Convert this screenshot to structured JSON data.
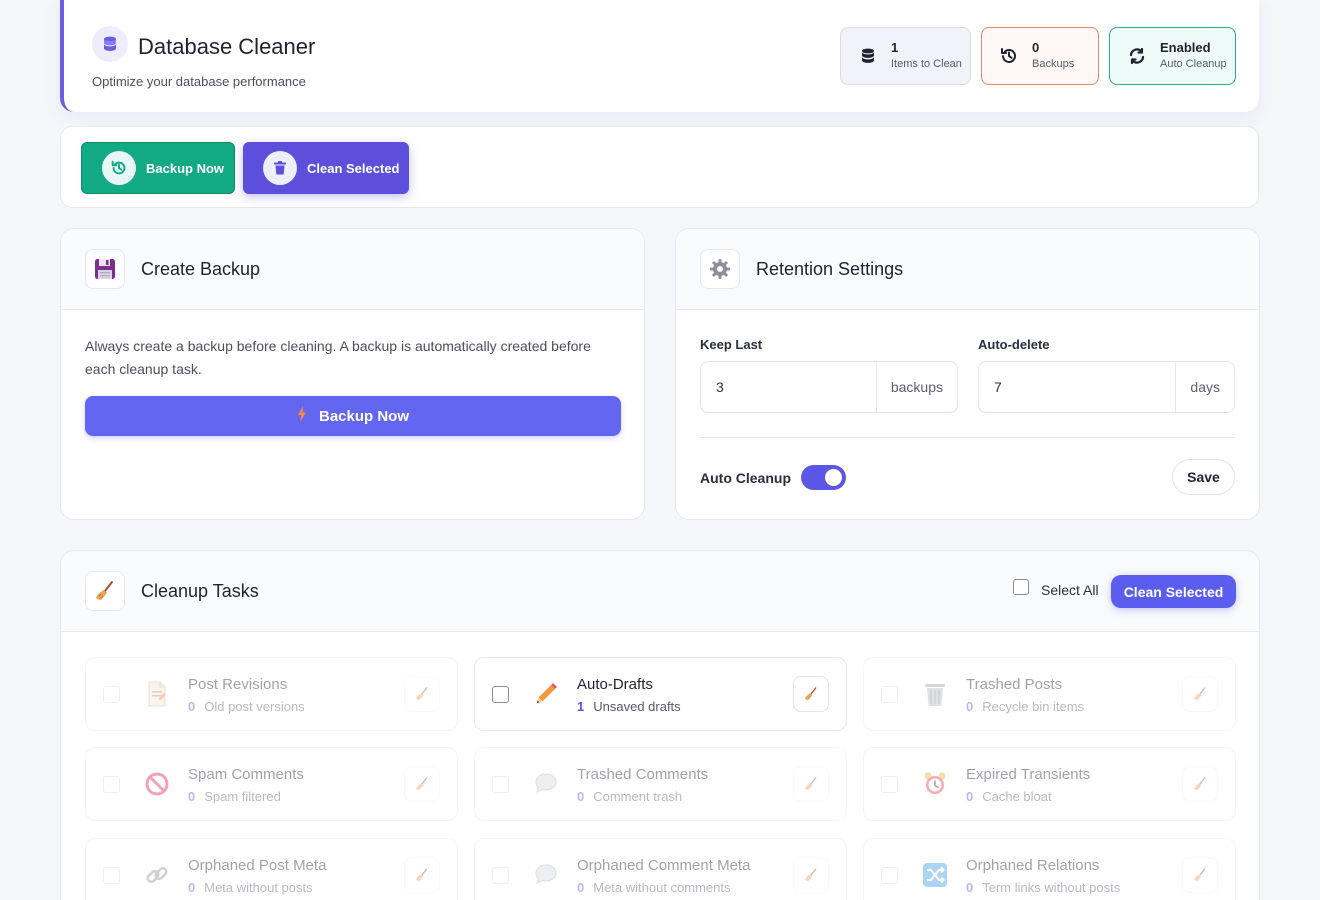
{
  "header": {
    "title": "Database Cleaner",
    "subtitle": "Optimize your database performance",
    "stats": [
      {
        "value": "1",
        "label": "Items to Clean",
        "icon": "database-icon"
      },
      {
        "value": "0",
        "label": "Backups",
        "icon": "history-icon"
      },
      {
        "value": "Enabled",
        "label": "Auto Cleanup",
        "icon": "sync-icon"
      }
    ]
  },
  "actionbar": {
    "backup_label": "Backup Now",
    "clean_label": "Clean Selected"
  },
  "backup_card": {
    "title": "Create Backup",
    "description": "Always create a backup before cleaning. A backup is automatically created before each cleanup task.",
    "button_label": "Backup Now"
  },
  "retention": {
    "title": "Retention Settings",
    "keep_last_label": "Keep Last",
    "keep_last_value": "3",
    "keep_last_unit": "backups",
    "auto_delete_label": "Auto-delete",
    "auto_delete_value": "7",
    "auto_delete_unit": "days",
    "auto_cleanup_label": "Auto Cleanup",
    "auto_cleanup_on": true,
    "save_label": "Save"
  },
  "tasks": {
    "title": "Cleanup Tasks",
    "select_all_label": "Select All",
    "clean_label": "Clean Selected",
    "items": [
      {
        "name": "Post Revisions",
        "count": "0",
        "desc": "Old post versions",
        "icon": "page-icon",
        "enabled": false
      },
      {
        "name": "Auto-Drafts",
        "count": "1",
        "desc": "Unsaved drafts",
        "icon": "pencil-icon",
        "enabled": true
      },
      {
        "name": "Trashed Posts",
        "count": "0",
        "desc": "Recycle bin items",
        "icon": "trash-can-icon",
        "enabled": false
      },
      {
        "name": "Spam Comments",
        "count": "0",
        "desc": "Spam filtered",
        "icon": "prohibited-icon",
        "enabled": false
      },
      {
        "name": "Trashed Comments",
        "count": "0",
        "desc": "Comment trash",
        "icon": "speech-bubble-icon",
        "enabled": false
      },
      {
        "name": "Expired Transients",
        "count": "0",
        "desc": "Cache bloat",
        "icon": "alarm-clock-icon",
        "enabled": false
      },
      {
        "name": "Orphaned Post Meta",
        "count": "0",
        "desc": "Meta without posts",
        "icon": "link-icon",
        "enabled": false
      },
      {
        "name": "Orphaned Comment Meta",
        "count": "0",
        "desc": "Meta without comments",
        "icon": "thought-bubble-icon",
        "enabled": false
      },
      {
        "name": "Orphaned Relations",
        "count": "0",
        "desc": "Term links without posts",
        "icon": "shuffle-icon",
        "enabled": false
      }
    ]
  }
}
